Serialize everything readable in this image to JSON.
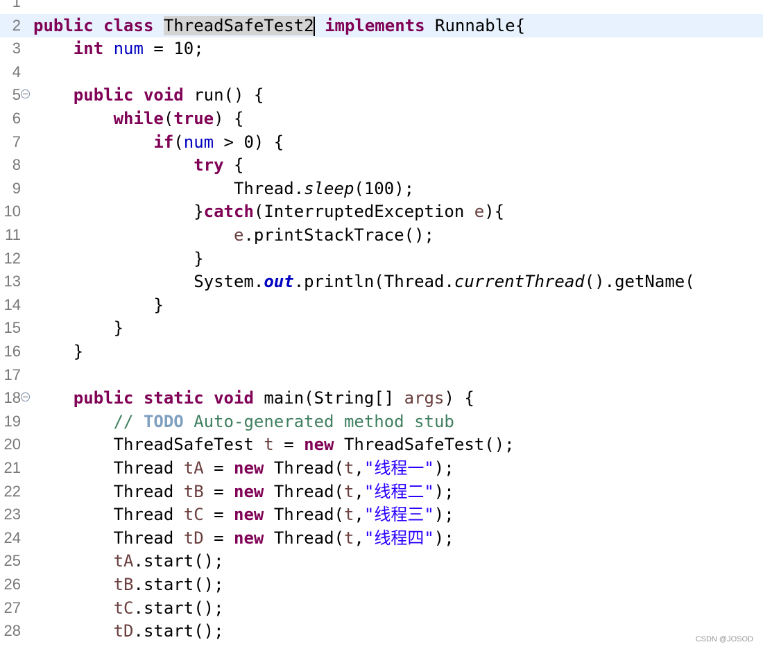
{
  "lines": [
    {
      "n": "1",
      "segments": []
    },
    {
      "n": "2",
      "current": true,
      "segments": [
        {
          "t": "public",
          "c": "kw"
        },
        {
          "t": " "
        },
        {
          "t": "class",
          "c": "kw"
        },
        {
          "t": " "
        },
        {
          "t": "ThreadSafeTest2",
          "c": "hl"
        },
        {
          "caret": true
        },
        {
          "t": " "
        },
        {
          "t": "implements",
          "c": "kw"
        },
        {
          "t": " Runnable{"
        }
      ]
    },
    {
      "n": "3",
      "segments": [
        {
          "t": "    "
        },
        {
          "t": "int",
          "c": "kw"
        },
        {
          "t": " "
        },
        {
          "t": "num",
          "c": "fld"
        },
        {
          "t": " = 10;"
        }
      ]
    },
    {
      "n": "4",
      "segments": []
    },
    {
      "n": "5",
      "fold": true,
      "segments": [
        {
          "t": "    "
        },
        {
          "t": "public",
          "c": "kw"
        },
        {
          "t": " "
        },
        {
          "t": "void",
          "c": "kw"
        },
        {
          "t": " run() {"
        }
      ]
    },
    {
      "n": "6",
      "segments": [
        {
          "t": "        "
        },
        {
          "t": "while",
          "c": "kw"
        },
        {
          "t": "("
        },
        {
          "t": "true",
          "c": "kw"
        },
        {
          "t": ") {"
        }
      ]
    },
    {
      "n": "7",
      "segments": [
        {
          "t": "            "
        },
        {
          "t": "if",
          "c": "kw"
        },
        {
          "t": "("
        },
        {
          "t": "num",
          "c": "fld"
        },
        {
          "t": " > 0) {"
        }
      ]
    },
    {
      "n": "8",
      "segments": [
        {
          "t": "                "
        },
        {
          "t": "try",
          "c": "kw"
        },
        {
          "t": " {"
        }
      ]
    },
    {
      "n": "9",
      "segments": [
        {
          "t": "                    Thread."
        },
        {
          "t": "sleep",
          "c": "ital"
        },
        {
          "t": "(100);"
        }
      ]
    },
    {
      "n": "10",
      "segments": [
        {
          "t": "                }"
        },
        {
          "t": "catch",
          "c": "kw"
        },
        {
          "t": "(InterruptedException "
        },
        {
          "t": "e",
          "c": "var"
        },
        {
          "t": "){"
        }
      ]
    },
    {
      "n": "11",
      "segments": [
        {
          "t": "                    "
        },
        {
          "t": "e",
          "c": "var"
        },
        {
          "t": ".printStackTrace();"
        }
      ]
    },
    {
      "n": "12",
      "segments": [
        {
          "t": "                }"
        }
      ]
    },
    {
      "n": "13",
      "segments": [
        {
          "t": "                System."
        },
        {
          "t": "out",
          "c": "sfld"
        },
        {
          "t": ".println(Thread."
        },
        {
          "t": "currentThread",
          "c": "ital"
        },
        {
          "t": "().getName("
        }
      ]
    },
    {
      "n": "14",
      "segments": [
        {
          "t": "            }"
        }
      ]
    },
    {
      "n": "15",
      "segments": [
        {
          "t": "        }"
        }
      ]
    },
    {
      "n": "16",
      "segments": [
        {
          "t": "    }"
        }
      ]
    },
    {
      "n": "17",
      "segments": []
    },
    {
      "n": "18",
      "fold": true,
      "segments": [
        {
          "t": "    "
        },
        {
          "t": "public",
          "c": "kw"
        },
        {
          "t": " "
        },
        {
          "t": "static",
          "c": "kw"
        },
        {
          "t": " "
        },
        {
          "t": "void",
          "c": "kw"
        },
        {
          "t": " main(String[] "
        },
        {
          "t": "args",
          "c": "var"
        },
        {
          "t": ") {"
        }
      ]
    },
    {
      "n": "19",
      "segments": [
        {
          "t": "        "
        },
        {
          "t": "// ",
          "c": "cmt"
        },
        {
          "t": "TODO",
          "c": "todo"
        },
        {
          "t": " Auto-generated method stub",
          "c": "cmt"
        }
      ]
    },
    {
      "n": "20",
      "segments": [
        {
          "t": "        ThreadSafeTest "
        },
        {
          "t": "t",
          "c": "var"
        },
        {
          "t": " = "
        },
        {
          "t": "new",
          "c": "kw"
        },
        {
          "t": " ThreadSafeTest();"
        }
      ]
    },
    {
      "n": "21",
      "segments": [
        {
          "t": "        Thread "
        },
        {
          "t": "tA",
          "c": "var"
        },
        {
          "t": " = "
        },
        {
          "t": "new",
          "c": "kw"
        },
        {
          "t": " Thread("
        },
        {
          "t": "t",
          "c": "var"
        },
        {
          "t": ","
        },
        {
          "t": "\"线程一\"",
          "c": "str"
        },
        {
          "t": ");"
        }
      ]
    },
    {
      "n": "22",
      "segments": [
        {
          "t": "        Thread "
        },
        {
          "t": "tB",
          "c": "var"
        },
        {
          "t": " = "
        },
        {
          "t": "new",
          "c": "kw"
        },
        {
          "t": " Thread("
        },
        {
          "t": "t",
          "c": "var"
        },
        {
          "t": ","
        },
        {
          "t": "\"线程二\"",
          "c": "str"
        },
        {
          "t": ");"
        }
      ]
    },
    {
      "n": "23",
      "segments": [
        {
          "t": "        Thread "
        },
        {
          "t": "tC",
          "c": "var"
        },
        {
          "t": " = "
        },
        {
          "t": "new",
          "c": "kw"
        },
        {
          "t": " Thread("
        },
        {
          "t": "t",
          "c": "var"
        },
        {
          "t": ","
        },
        {
          "t": "\"线程三\"",
          "c": "str"
        },
        {
          "t": ");"
        }
      ]
    },
    {
      "n": "24",
      "segments": [
        {
          "t": "        Thread "
        },
        {
          "t": "tD",
          "c": "var"
        },
        {
          "t": " = "
        },
        {
          "t": "new",
          "c": "kw"
        },
        {
          "t": " Thread("
        },
        {
          "t": "t",
          "c": "var"
        },
        {
          "t": ","
        },
        {
          "t": "\"线程四\"",
          "c": "str"
        },
        {
          "t": ");"
        }
      ]
    },
    {
      "n": "25",
      "segments": [
        {
          "t": "        "
        },
        {
          "t": "tA",
          "c": "var"
        },
        {
          "t": ".start();"
        }
      ]
    },
    {
      "n": "26",
      "segments": [
        {
          "t": "        "
        },
        {
          "t": "tB",
          "c": "var"
        },
        {
          "t": ".start();"
        }
      ]
    },
    {
      "n": "27",
      "segments": [
        {
          "t": "        "
        },
        {
          "t": "tC",
          "c": "var"
        },
        {
          "t": ".start();"
        }
      ]
    },
    {
      "n": "28",
      "segments": [
        {
          "t": "        "
        },
        {
          "t": "tD",
          "c": "var"
        },
        {
          "t": ".start();"
        }
      ]
    }
  ],
  "watermark": "CSDN @JOSOD"
}
